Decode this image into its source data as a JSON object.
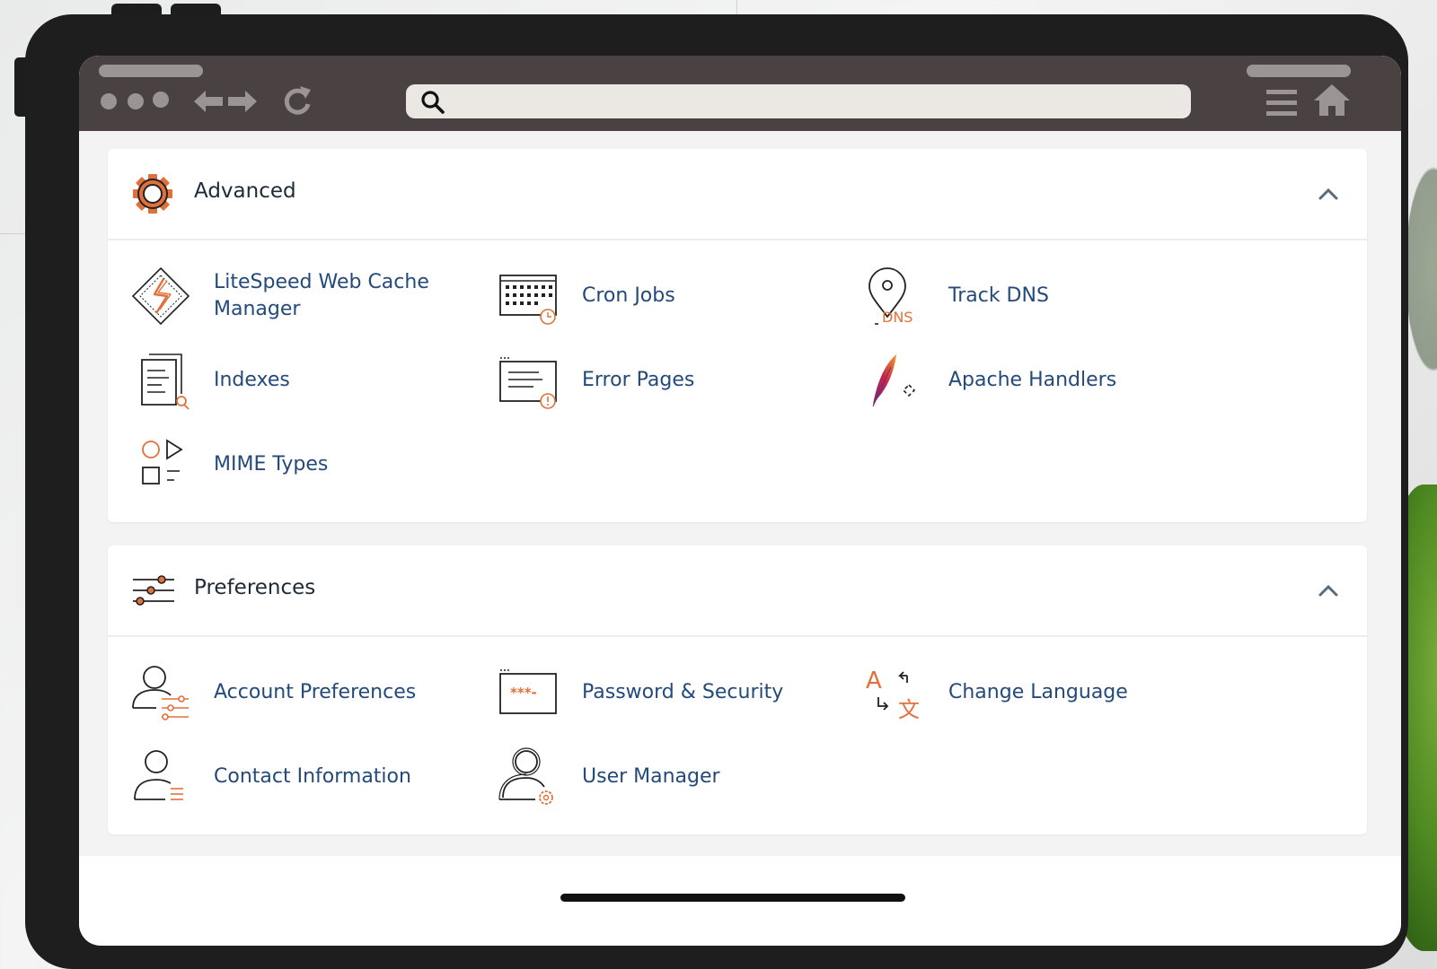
{
  "browser": {
    "search": {
      "placeholder": "",
      "value": ""
    },
    "icons": [
      "window-dots-icon",
      "back-arrow-icon",
      "forward-arrow-icon",
      "reload-icon",
      "search-icon",
      "menu-icon",
      "home-icon"
    ]
  },
  "colors": {
    "accent": "#e2703a",
    "link": "#234a7a",
    "heading": "#1d2b36",
    "toolbar": "#4a4242"
  },
  "sections": [
    {
      "title": "Advanced",
      "icon": "gear-icon",
      "items": [
        {
          "label": "LiteSpeed Web Cache Manager",
          "icon": "litespeed-icon"
        },
        {
          "label": "Cron Jobs",
          "icon": "calendar-clock-icon"
        },
        {
          "label": "Track DNS",
          "icon": "map-pin-dns-icon"
        },
        {
          "label": "Indexes",
          "icon": "document-search-icon"
        },
        {
          "label": "Error Pages",
          "icon": "error-page-icon"
        },
        {
          "label": "Apache Handlers",
          "icon": "apache-feather-icon"
        },
        {
          "label": "MIME Types",
          "icon": "shapes-icon"
        }
      ]
    },
    {
      "title": "Preferences",
      "icon": "sliders-icon",
      "items": [
        {
          "label": "Account Preferences",
          "icon": "user-sliders-icon"
        },
        {
          "label": "Password & Security",
          "icon": "password-field-icon"
        },
        {
          "label": "Change Language",
          "icon": "translate-icon"
        },
        {
          "label": "Contact Information",
          "icon": "user-list-icon"
        },
        {
          "label": "User Manager",
          "icon": "user-gear-icon"
        }
      ]
    }
  ]
}
